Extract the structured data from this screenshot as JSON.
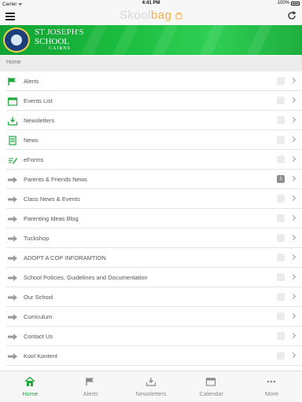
{
  "status_bar": {
    "carrier": "Carrier ᯤ",
    "time": "4:41 PM",
    "battery_text": "100%"
  },
  "nav_bar": {
    "title_main": "Skool",
    "title_accent": "bag"
  },
  "banner": {
    "school_line1": "ST JOSEPH'S",
    "school_line2": "SCHOOL",
    "school_location": "CAIRNS"
  },
  "breadcrumb": "Home",
  "colors": {
    "brand_green": "#1fa83c",
    "banner_green": "#1bbd3f",
    "accent_orange": "#f2b24b"
  },
  "menu_items": [
    {
      "label": "Alerts",
      "icon": "flag-icon",
      "badge": ""
    },
    {
      "label": "Events List",
      "icon": "calendar-icon",
      "badge": ""
    },
    {
      "label": "Newsletters",
      "icon": "inbox-download-icon",
      "badge": ""
    },
    {
      "label": "News",
      "icon": "news-document-icon",
      "badge": ""
    },
    {
      "label": "eForms",
      "icon": "eform-pen-icon",
      "badge": ""
    },
    {
      "label": "Parents & Friends News",
      "icon": "arrow-right-icon",
      "badge": "1"
    },
    {
      "label": "Class News & Events",
      "icon": "arrow-right-icon",
      "badge": ""
    },
    {
      "label": "Parenting Ideas Blog",
      "icon": "arrow-right-icon",
      "badge": ""
    },
    {
      "label": "Tuckshop",
      "icon": "arrow-right-icon",
      "badge": ""
    },
    {
      "label": "ADOPT A COP INFORAMTION",
      "icon": "arrow-right-icon",
      "badge": ""
    },
    {
      "label": "School Policies, Guidelines and Documentation",
      "icon": "arrow-right-icon",
      "badge": ""
    },
    {
      "label": "Our School",
      "icon": "arrow-right-icon",
      "badge": ""
    },
    {
      "label": "Curriculum",
      "icon": "arrow-right-icon",
      "badge": ""
    },
    {
      "label": "Contact Us",
      "icon": "arrow-right-icon",
      "badge": ""
    },
    {
      "label": "Kool Kontent",
      "icon": "arrow-right-icon",
      "badge": ""
    }
  ],
  "tabs": [
    {
      "label": "Home",
      "icon": "home-icon",
      "active": true
    },
    {
      "label": "Alerts",
      "icon": "flag-icon",
      "active": false
    },
    {
      "label": "Newsletters",
      "icon": "inbox-download-icon",
      "active": false
    },
    {
      "label": "Calendar",
      "icon": "calendar-icon",
      "active": false
    },
    {
      "label": "More",
      "icon": "more-dots-icon",
      "active": false
    }
  ]
}
